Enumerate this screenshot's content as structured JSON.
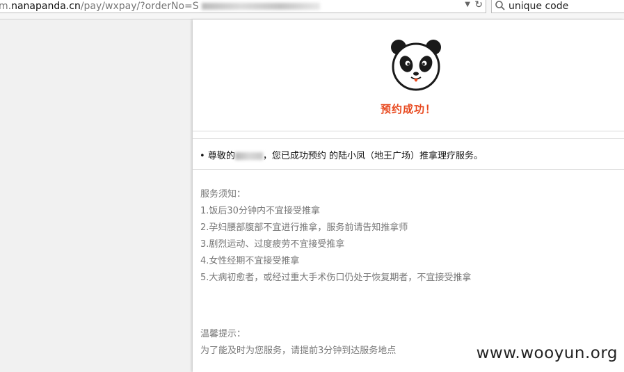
{
  "browser": {
    "url_prefix": "m.",
    "url_host": "nanapanda.cn",
    "url_path": "/pay/wxpay/?orderNo=S",
    "search_query": "unique code"
  },
  "header": {
    "success_text": "预约成功！"
  },
  "greeting": {
    "prefix": "尊敬的",
    "suffix": "，您已成功预约 的陆小凤（地王广场）推拿理疗服务。"
  },
  "notice": {
    "title": "服务须知：",
    "items": [
      "1.饭后30分钟内不宜接受推拿",
      "2.孕妇腰部腹部不宜进行推拿，服务前请告知推拿师",
      "3.剧烈运动、过度疲劳不宜接受推拿",
      "4.女性经期不宜接受推拿",
      "5.大病初愈者，或经过重大手术伤口仍处于恢复期者，不宜接受推拿"
    ]
  },
  "tips": {
    "title": "温馨提示：",
    "text": "为了能及时为您服务，请提前3分钟到达服务地点"
  },
  "watermark": "www.wooyun.org"
}
